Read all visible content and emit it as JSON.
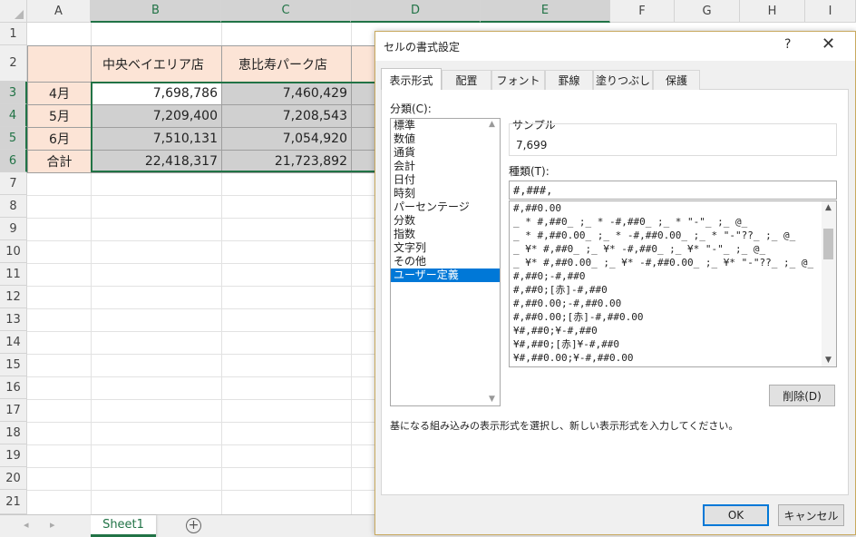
{
  "sheet": {
    "columns": [
      "A",
      "B",
      "C",
      "D",
      "E",
      "F",
      "G",
      "H",
      "I"
    ],
    "rows": [
      "1",
      "2",
      "3",
      "4",
      "5",
      "6",
      "7",
      "8",
      "9",
      "10",
      "11",
      "12",
      "13",
      "14",
      "15",
      "16",
      "17",
      "18",
      "19",
      "20",
      "21"
    ],
    "header_row": {
      "b": "中央ベイエリア店",
      "c": "恵比寿パーク店"
    },
    "data_rows": [
      {
        "label": "4月",
        "b": "7,698,786",
        "c": "7,460,429"
      },
      {
        "label": "5月",
        "b": "7,209,400",
        "c": "7,208,543"
      },
      {
        "label": "6月",
        "b": "7,510,131",
        "c": "7,054,920"
      },
      {
        "label": "合計",
        "b": "22,418,317",
        "c": "21,723,892"
      }
    ],
    "sheet_tab": "Sheet1",
    "add_sheet_icon": "⊕",
    "nav_prev_icon": "◂",
    "nav_next_icon": "▸"
  },
  "dialog": {
    "title": "セルの書式設定",
    "help_icon": "?",
    "close_icon": "✕",
    "tabs": [
      "表示形式",
      "配置",
      "フォント",
      "罫線",
      "塗りつぶし",
      "保護"
    ],
    "category_label": "分類(C):",
    "categories": [
      "標準",
      "数値",
      "通貨",
      "会計",
      "日付",
      "時刻",
      "パーセンテージ",
      "分数",
      "指数",
      "文字列",
      "その他",
      "ユーザー定義"
    ],
    "selected_category": "ユーザー定義",
    "sample_label": "サンプル",
    "sample_value": "7,699",
    "type_label": "種類(T):",
    "type_value": "#,###,",
    "formats": [
      "#,##0.00",
      "_ * #,##0_ ;_ * -#,##0_ ;_ * \"-\"_ ;_ @_",
      "_ * #,##0.00_ ;_ * -#,##0.00_ ;_ * \"-\"??_ ;_ @_",
      "_ ¥* #,##0_ ;_ ¥* -#,##0_ ;_ ¥* \"-\"_ ;_ @_",
      "_ ¥* #,##0.00_ ;_ ¥* -#,##0.00_ ;_ ¥* \"-\"??_ ;_ @_",
      "#,##0;-#,##0",
      "#,##0;[赤]-#,##0",
      "#,##0.00;-#,##0.00",
      "#,##0.00;[赤]-#,##0.00",
      "¥#,##0;¥-#,##0",
      "¥#,##0;[赤]¥-#,##0",
      "¥#,##0.00;¥-#,##0.00"
    ],
    "delete_button": "削除(D)",
    "description": "基になる組み込みの表示形式を選択し、新しい表示形式を入力してください。",
    "ok_button": "OK",
    "cancel_button": "キャンセル",
    "scroll_up_icon": "▲",
    "scroll_down_icon": "▼",
    "accent_color": "#0078d7",
    "sheet_accent_color": "#217346"
  }
}
